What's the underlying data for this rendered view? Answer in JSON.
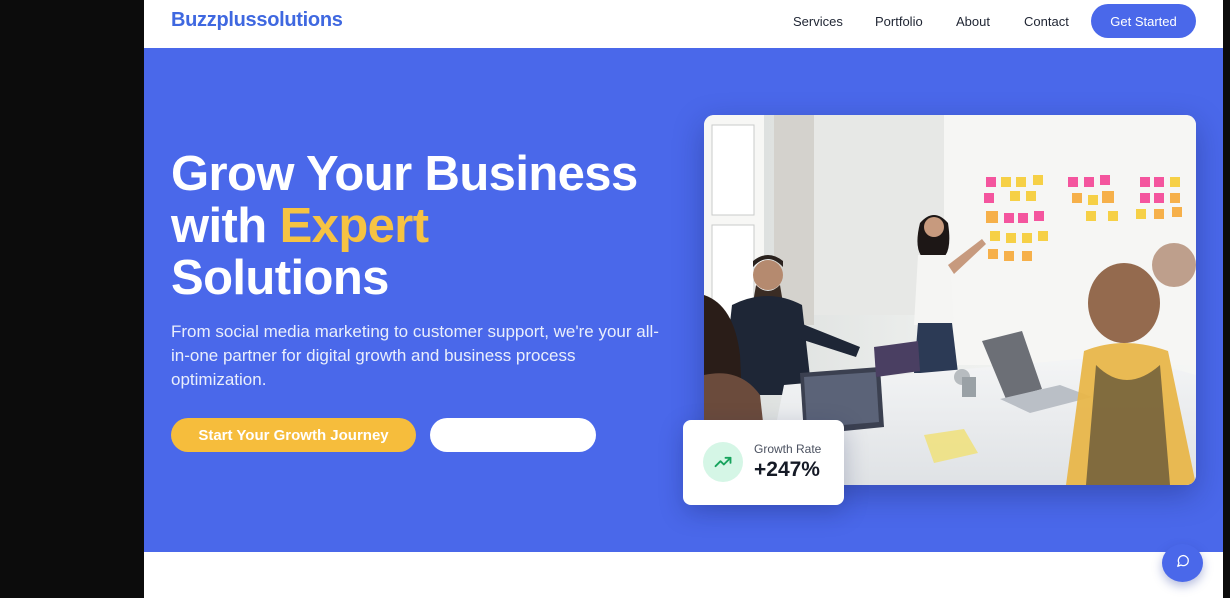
{
  "header": {
    "brand": "Buzzplussolutions",
    "nav": {
      "services": "Services",
      "portfolio": "Portfolio",
      "about": "About",
      "contact": "Contact"
    },
    "cta": "Get Started"
  },
  "hero": {
    "title_line1": "Grow Your Business",
    "title_line2_prefix": "with ",
    "title_line2_accent": "Expert",
    "title_line3": "Solutions",
    "subtitle": "From social media marketing to customer support, we're your all-in-one partner for digital growth and business process optimization.",
    "primary_button": "Start Your Growth Journey",
    "secondary_button": ""
  },
  "stat_card": {
    "label": "Growth Rate",
    "value": "+247%",
    "icon": "trending-up-icon"
  },
  "chat": {
    "icon": "chat-bubble-icon"
  },
  "colors": {
    "brand": "#3f68e0",
    "hero_bg": "#4a68ea",
    "accent": "#f6c343",
    "primary_button": "#f6bd3c",
    "growth_icon_bg": "#d5f6e6",
    "growth_icon": "#17a35d"
  }
}
